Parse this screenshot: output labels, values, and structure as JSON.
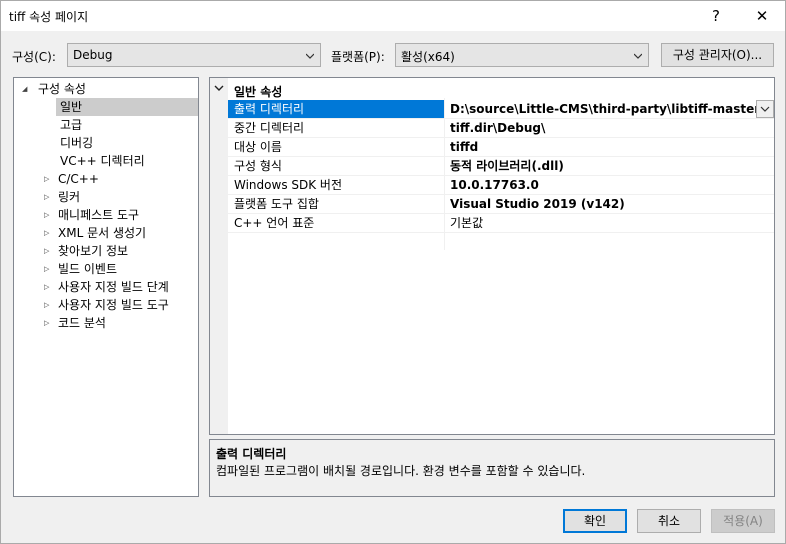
{
  "window": {
    "title": "tiff 속성 페이지",
    "help_label": "?",
    "close_label": "✕"
  },
  "toolbar": {
    "config_label": "구성(C):",
    "config_value": "Debug",
    "platform_label": "플랫폼(P):",
    "platform_value": "활성(x64)",
    "config_manager_label": "구성 관리자(O)..."
  },
  "tree": {
    "root": "구성 속성",
    "items": [
      {
        "label": "일반",
        "expandable": false,
        "selected": true
      },
      {
        "label": "고급",
        "expandable": false
      },
      {
        "label": "디버깅",
        "expandable": false
      },
      {
        "label": "VC++ 디렉터리",
        "expandable": false
      },
      {
        "label": "C/C++",
        "expandable": true
      },
      {
        "label": "링커",
        "expandable": true
      },
      {
        "label": "매니페스트 도구",
        "expandable": true
      },
      {
        "label": "XML 문서 생성기",
        "expandable": true
      },
      {
        "label": "찾아보기 정보",
        "expandable": true
      },
      {
        "label": "빌드 이벤트",
        "expandable": true
      },
      {
        "label": "사용자 지정 빌드 단계",
        "expandable": true
      },
      {
        "label": "사용자 지정 빌드 도구",
        "expandable": true
      },
      {
        "label": "코드 분석",
        "expandable": true
      }
    ]
  },
  "grid": {
    "category": "일반 속성",
    "rows": [
      {
        "name": "출력 디렉터리",
        "value": "D:\\source\\Little-CMS\\third-party\\libtiff-master\\pr"
      },
      {
        "name": "중간 디렉터리",
        "value": "tiff.dir\\Debug\\"
      },
      {
        "name": "대상 이름",
        "value": "tiffd"
      },
      {
        "name": "구성 형식",
        "value": "동적 라이브러리(.dll)"
      },
      {
        "name": "Windows SDK 버전",
        "value": "10.0.17763.0"
      },
      {
        "name": "플랫폼 도구 집합",
        "value": "Visual Studio 2019 (v142)"
      },
      {
        "name": "C++ 언어 표준",
        "value": "기본값"
      }
    ]
  },
  "description": {
    "title": "출력 디렉터리",
    "text": "컴파일된 프로그램이 배치될 경로입니다. 환경 변수를 포함할 수 있습니다."
  },
  "buttons": {
    "ok": "확인",
    "cancel": "취소",
    "apply": "적용(A)"
  }
}
